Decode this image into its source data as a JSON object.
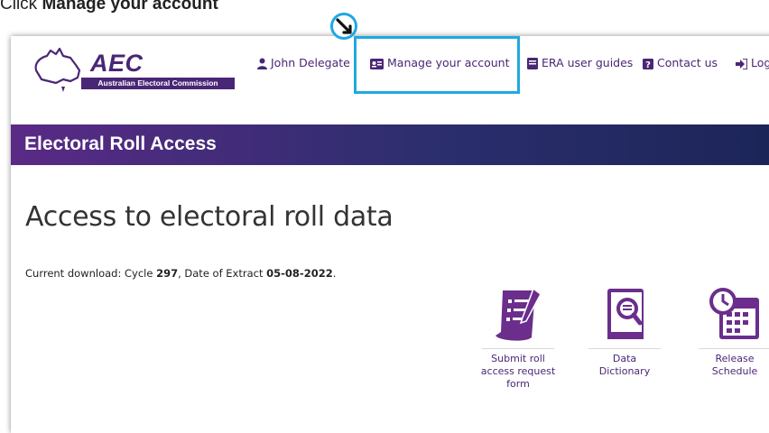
{
  "instruction": {
    "prefix": "Click ",
    "target": "Manage your account"
  },
  "header": {
    "logo_text": "AEC",
    "logo_subtitle": "Australian Electoral Commission",
    "nav": [
      {
        "label": "John Delegate",
        "icon": "user-icon"
      },
      {
        "label": "Manage your account",
        "icon": "id-card-icon"
      },
      {
        "label": "ERA user guides",
        "icon": "book-icon"
      },
      {
        "label": "Contact us",
        "icon": "question-icon"
      },
      {
        "label": "Log",
        "icon": "logout-icon"
      }
    ]
  },
  "banner": {
    "title": "Electoral Roll Access"
  },
  "main": {
    "title": "Access to electoral roll data",
    "download": {
      "prefix": "Current download: Cycle ",
      "cycle": "297",
      "middle": ", Date of Extract ",
      "date": "05-08-2022",
      "suffix": "."
    },
    "tiles": [
      {
        "label": "Submit roll\naccess request\nform",
        "icon": "form-icon"
      },
      {
        "label": "Data\nDictionary",
        "icon": "dictionary-icon"
      },
      {
        "label": "Release\nSchedule",
        "icon": "calendar-icon"
      }
    ]
  },
  "colors": {
    "brand": "#4a2676",
    "highlight": "#1fa9e0",
    "banner_start": "#5a2a86",
    "banner_end": "#1c2558"
  }
}
